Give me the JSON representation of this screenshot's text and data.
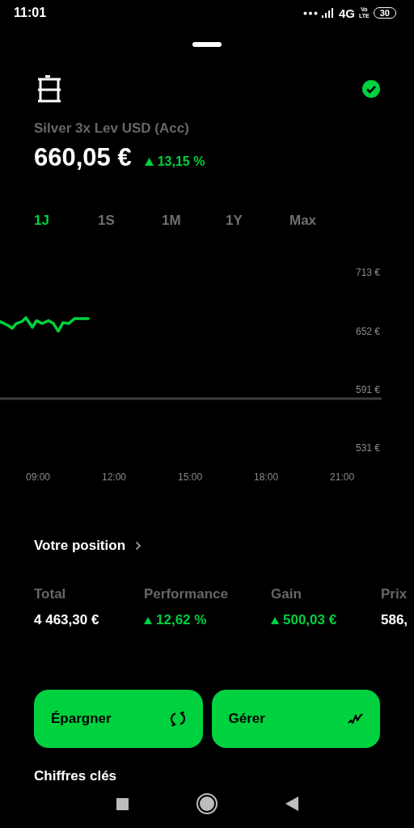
{
  "status_bar": {
    "time": "11:01",
    "network": "4G",
    "volte_top": "Vo",
    "volte_bottom": "LTE",
    "battery": "30"
  },
  "header": {
    "verified": true
  },
  "asset": {
    "name": "Silver 3x Lev USD (Acc)",
    "price": "660,05 €",
    "change": {
      "value": "13,15 %",
      "kind": "up"
    }
  },
  "ranges": [
    {
      "label": "1J",
      "selected": true
    },
    {
      "label": "1S",
      "selected": false
    },
    {
      "label": "1M",
      "selected": false
    },
    {
      "label": "1Y",
      "selected": false
    },
    {
      "label": "Max",
      "selected": false
    }
  ],
  "chart_data": {
    "type": "line",
    "x": [
      7.5,
      7.82,
      7.98,
      8.14,
      8.36,
      8.52,
      8.78,
      8.94,
      9.16,
      9.41,
      9.61,
      9.8,
      9.99,
      10.21,
      10.44,
      10.69,
      10.98
    ],
    "series": [
      {
        "color": "#00d13f",
        "values": [
          662,
          658,
          655,
          660,
          662,
          666,
          656,
          663,
          660,
          663,
          660,
          652,
          661,
          660,
          665,
          665,
          665
        ]
      }
    ],
    "xlim": [
      7.5,
      22.56
    ],
    "ylim": [
      531,
      713
    ],
    "ref_lines": [
      {
        "axis": "y",
        "value": 582
      }
    ],
    "xticks": [
      {
        "value": 9,
        "label": "09:00"
      },
      {
        "value": 12,
        "label": "12:00"
      },
      {
        "value": 15,
        "label": "15:00"
      },
      {
        "value": 18,
        "label": "18:00"
      },
      {
        "value": 21,
        "label": "21:00"
      }
    ],
    "yticks": [
      {
        "value": 713,
        "label": "713 €"
      },
      {
        "value": 652,
        "label": "652 €"
      },
      {
        "value": 591,
        "label": "591 €"
      },
      {
        "value": 531,
        "label": "531 €"
      }
    ]
  },
  "position": {
    "title": "Votre position",
    "stats": [
      {
        "label": "Total",
        "value": "4 463,30 €",
        "kind": "plain"
      },
      {
        "label": "Performance",
        "value": "12,62 %",
        "kind": "up"
      },
      {
        "label": "Gain",
        "value": "500,03 €",
        "kind": "up"
      },
      {
        "label": "Prix",
        "value": "586,",
        "kind": "plain"
      }
    ]
  },
  "actions": [
    {
      "label": "Épargner",
      "kind": "savings"
    },
    {
      "label": "Gérer",
      "kind": "manage"
    }
  ],
  "key_figures": {
    "title": "Chiffres clés"
  }
}
